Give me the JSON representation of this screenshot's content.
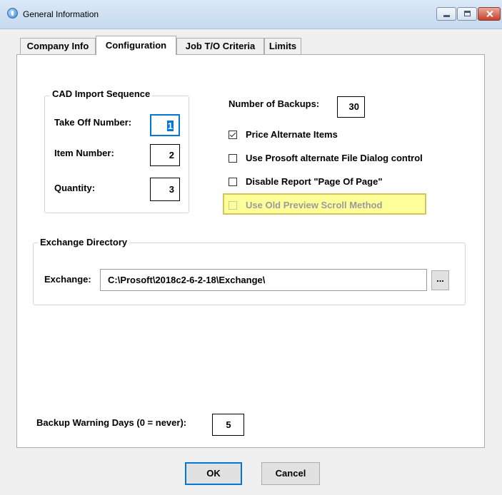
{
  "window": {
    "title": "General Information"
  },
  "tabs": [
    {
      "label": "Company Info"
    },
    {
      "label": "Configuration",
      "active": true
    },
    {
      "label": "Job T/O Criteria"
    },
    {
      "label": "Limits"
    }
  ],
  "cad_import": {
    "legend": "CAD Import Sequence",
    "take_off_number": {
      "label": "Take Off Number:",
      "value": "1"
    },
    "item_number": {
      "label": "Item Number:",
      "value": "2"
    },
    "quantity": {
      "label": "Quantity:",
      "value": "3"
    }
  },
  "backups": {
    "label": "Number of Backups:",
    "value": "30"
  },
  "options": [
    {
      "label": "Price Alternate Items",
      "checked": true
    },
    {
      "label": "Use Prosoft alternate File Dialog control",
      "checked": false
    },
    {
      "label": "Disable Report \"Page Of Page\"",
      "checked": false
    },
    {
      "label": "Use Old Preview Scroll Method",
      "checked": false,
      "disabled": true
    }
  ],
  "exchange": {
    "legend": "Exchange Directory",
    "label": "Exchange:",
    "path": "C:\\Prosoft\\2018c2-6-2-18\\Exchange\\",
    "browse_label": "..."
  },
  "backup_warning": {
    "label": "Backup Warning Days (0 = never):",
    "value": "5"
  },
  "buttons": {
    "ok": "OK",
    "cancel": "Cancel"
  },
  "colors": {
    "highlight": "#ffff99",
    "accent": "#0078d7",
    "disabled_text": "#9a9a9a"
  }
}
